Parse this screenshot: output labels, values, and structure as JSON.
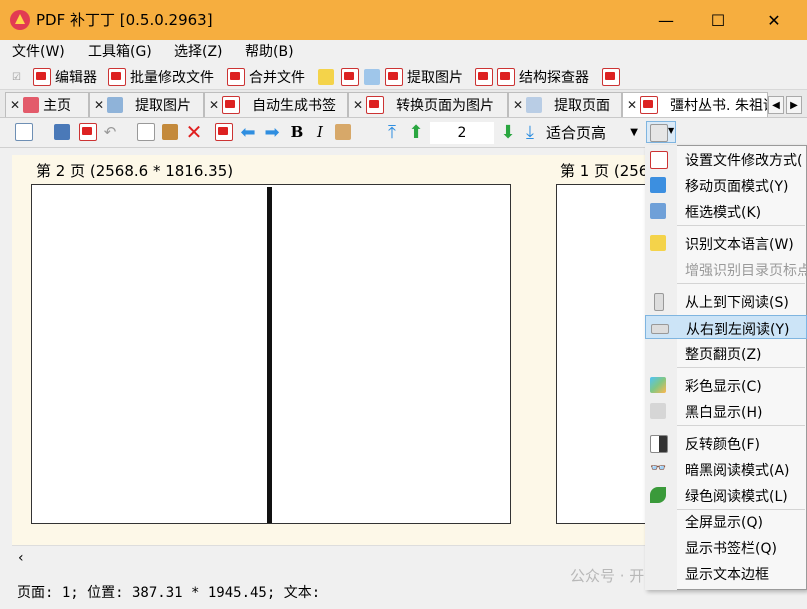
{
  "window": {
    "title": "PDF 补丁丁 [0.5.0.2963]",
    "minimize": "—",
    "maximize": "☐",
    "close": "✕"
  },
  "menubar": [
    "文件(W)",
    "工具箱(G)",
    "选择(Z)",
    "帮助(B)"
  ],
  "toolbar": {
    "editor": "编辑器",
    "batch_modify": "批量修改文件",
    "merge": "合并文件",
    "extract_images": "提取图片",
    "struct_inspector": "结构探查器"
  },
  "tabs": [
    {
      "label": "主页",
      "active": false
    },
    {
      "label": "提取图片",
      "active": false
    },
    {
      "label": "自动生成书签",
      "active": false
    },
    {
      "label": "转换页面为图片",
      "active": false
    },
    {
      "label": "提取页面",
      "active": false
    },
    {
      "label": "彊村丛书. 朱祖谋",
      "active": true
    }
  ],
  "viewer_toolbar": {
    "page_number": "2",
    "zoom_mode": "适合页高",
    "bold": "B",
    "italic": "I"
  },
  "pages": [
    {
      "label": "第 2 页 (2568.6 * 1816.35)"
    },
    {
      "label": "第 1 页 (256"
    }
  ],
  "context_menu": [
    {
      "label": "设置文件修改方式(",
      "enabled": true,
      "selected": false,
      "icon": "pdf-gear-icon"
    },
    {
      "label": "移动页面模式(Y)",
      "enabled": true,
      "selected": false,
      "icon": "move-arrows-icon"
    },
    {
      "label": "框选模式(K)",
      "enabled": true,
      "selected": false,
      "icon": "frame-select-icon"
    },
    {
      "label": "识别文本语言(W)",
      "enabled": true,
      "selected": false,
      "icon": "ocr-language-icon"
    },
    {
      "label": "增强识别目录页标点",
      "enabled": false,
      "selected": false,
      "icon": ""
    },
    {
      "label": "从上到下阅读(S)",
      "enabled": true,
      "selected": false,
      "icon": "top-to-bottom-icon"
    },
    {
      "label": "从右到左阅读(Y)",
      "enabled": true,
      "selected": true,
      "icon": "right-to-left-icon"
    },
    {
      "label": "整页翻页(Z)",
      "enabled": true,
      "selected": false,
      "icon": ""
    },
    {
      "label": "彩色显示(C)",
      "enabled": true,
      "selected": false,
      "icon": "color-display-icon"
    },
    {
      "label": "黑白显示(H)",
      "enabled": true,
      "selected": false,
      "icon": "grayscale-display-icon"
    },
    {
      "label": "反转颜色(F)",
      "enabled": true,
      "selected": false,
      "icon": "invert-color-icon"
    },
    {
      "label": "暗黑阅读模式(A)",
      "enabled": true,
      "selected": false,
      "icon": "glasses-icon"
    },
    {
      "label": "绿色阅读模式(L)",
      "enabled": true,
      "selected": false,
      "icon": "green-leaf-icon"
    },
    {
      "label": "全屏显示(Q)",
      "enabled": true,
      "selected": false,
      "icon": ""
    },
    {
      "label": "显示书签栏(Q)",
      "enabled": true,
      "selected": false,
      "icon": ""
    },
    {
      "label": "显示文本边框",
      "enabled": true,
      "selected": false,
      "icon": ""
    }
  ],
  "statusbar": {
    "text": "页面: 1; 位置: 387.31 * 1945.45; 文本:"
  },
  "watermark": "公众号 · 开源智能",
  "colors": {
    "titlebar": "#f6ae3f",
    "viewer_bg": "#fdf8e8",
    "selection": "#cce4f7",
    "arrow_blue": "#2f8ee0",
    "arrow_green": "#2aa640"
  }
}
